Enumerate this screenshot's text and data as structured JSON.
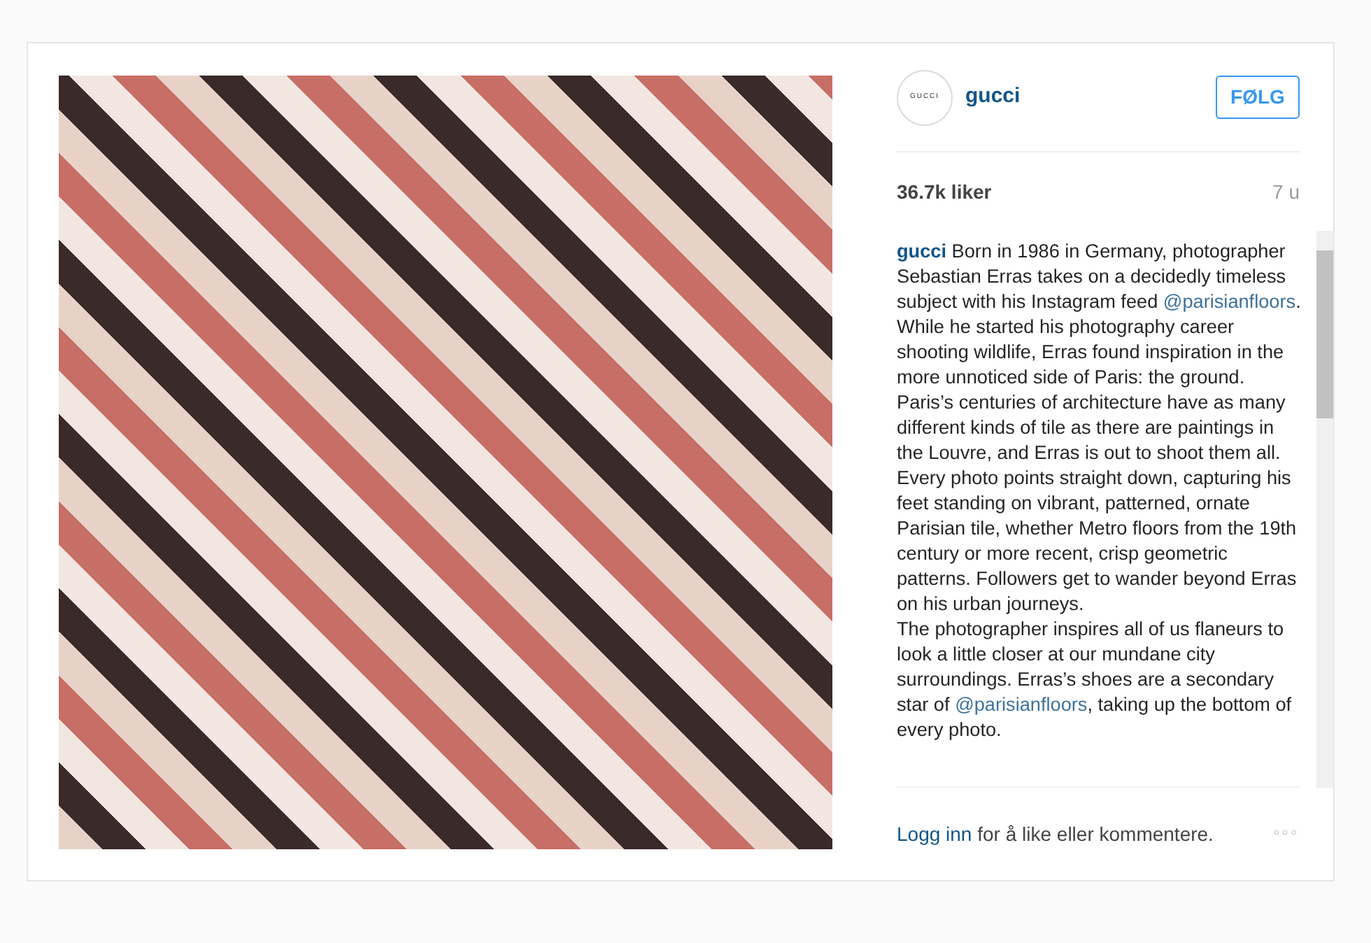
{
  "account": {
    "avatar_text": "GUCCI",
    "username": "gucci"
  },
  "follow_button": {
    "label": "FØLG"
  },
  "likes": "36.7k liker",
  "time": "7 u",
  "caption": [
    [
      {
        "kind": "user",
        "text": "gucci"
      },
      {
        "kind": "text",
        "text": " Born in 1986 in Germany, photographer Sebastian Erras takes on a decidedly timeless subject with his Instagram feed "
      },
      {
        "kind": "mention",
        "text": "@parisianfloors"
      },
      {
        "kind": "text",
        "text": ". While he started his photography career shooting wildlife, Erras found inspiration in the more unnoticed side of Paris: the ground. Paris’s centuries of architecture have as many different kinds of tile as there are paintings in the Louvre, and Erras is out to shoot them all. Every photo points straight down, capturing his feet standing on vibrant, patterned, ornate Parisian tile, whether Metro floors from the 19th century or more recent, crisp geometric patterns. Followers get to wander beyond Erras on his urban journeys."
      }
    ],
    [
      {
        "kind": "text",
        "text": "The photographer inspires all of us flaneurs to look a little closer at our mundane city surroundings. Erras’s shoes are a secondary star of "
      },
      {
        "kind": "mention",
        "text": "@parisianfloors"
      },
      {
        "kind": "text",
        "text": ", taking up the bottom of every photo."
      }
    ]
  ],
  "footer": {
    "login_link": "Logg inn",
    "text": " for å like eller kommentere.",
    "more": "○○○"
  }
}
